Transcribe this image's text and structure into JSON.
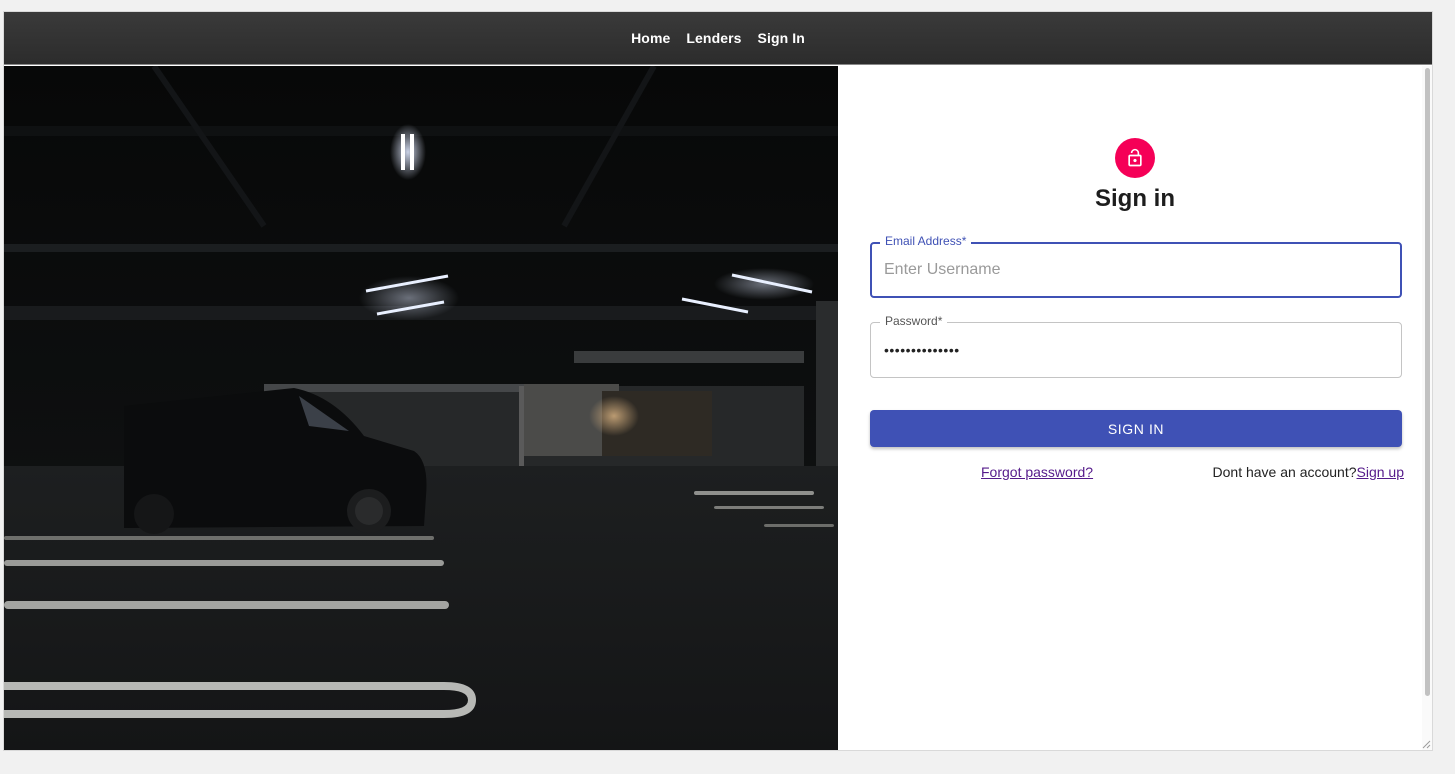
{
  "nav": {
    "items": [
      {
        "label": "Home"
      },
      {
        "label": "Lenders"
      },
      {
        "label": "Sign In"
      }
    ]
  },
  "hero": {
    "image": "dark-parking-garage-photo"
  },
  "form": {
    "icon": "lock-icon",
    "title": "Sign in",
    "email": {
      "label": "Email Address",
      "required_mark": "*",
      "placeholder": "Enter Username",
      "value": ""
    },
    "password": {
      "label": "Password",
      "required_mark": "*",
      "value": "••••••••••••••"
    },
    "submit_label": "SIGN IN",
    "forgot_label": "Forgot password?",
    "signup_prompt": "Dont have an account?",
    "signup_label": "Sign up"
  },
  "colors": {
    "primary": "#3f51b5",
    "avatar": "#f50057",
    "link": "#551a8b",
    "navbar": "#333333"
  }
}
